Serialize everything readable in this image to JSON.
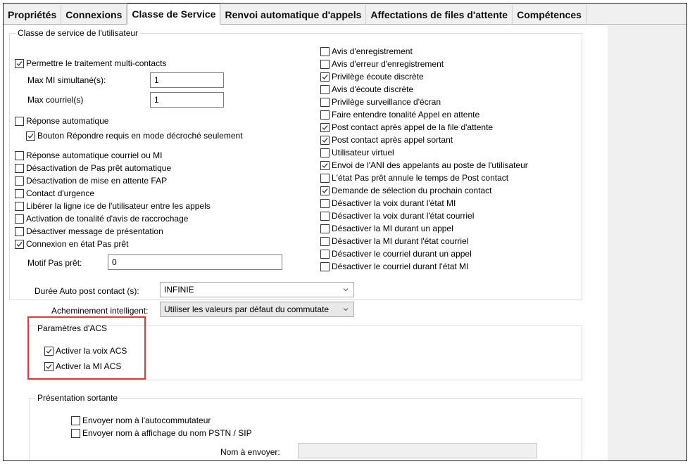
{
  "tabs": [
    {
      "label": "Propriétés",
      "active": false
    },
    {
      "label": "Connexions",
      "active": false
    },
    {
      "label": "Classe de Service",
      "active": true
    },
    {
      "label": "Renvoi automatique d'appels",
      "active": false
    },
    {
      "label": "Affectations de files d'attente",
      "active": false
    },
    {
      "label": "Compétences",
      "active": false
    }
  ],
  "cos_group": {
    "title": "Classe de service de l'utilisateur"
  },
  "multi_contact": {
    "label": "Permettre le traitement multi-contacts",
    "checked": true,
    "max_im_label": "Max MI simultané(s):",
    "max_im_value": "1",
    "max_email_label": "Max courriel(s)",
    "max_email_value": "1"
  },
  "auto_answer": {
    "label": "Réponse automatique",
    "checked": false,
    "sub_label": "Bouton Répondre requis en mode décroché seulement",
    "sub_checked": true
  },
  "left_options": [
    {
      "label": "Réponse automatique courriel ou MI",
      "checked": false
    },
    {
      "label": "Désactivation de Pas prêt automatique",
      "checked": false
    },
    {
      "label": "Désactivation de mise en attente FAP",
      "checked": false
    },
    {
      "label": "Contact d'urgence",
      "checked": false
    },
    {
      "label": "Libérer la ligne ice de l'utilisateur entre les appels",
      "checked": false
    },
    {
      "label": "Activation de tonalité d'avis de raccrochage",
      "checked": false
    },
    {
      "label": "Désactiver message de présentation",
      "checked": false
    },
    {
      "label": "Connexion en état Pas prêt",
      "checked": true
    }
  ],
  "not_ready_reason": {
    "label": "Motif Pas prêt:",
    "value": "0"
  },
  "right_options": [
    {
      "label": "Avis d'enregistrement",
      "checked": false
    },
    {
      "label": "Avis d'erreur d'enregistrement",
      "checked": false
    },
    {
      "label": "Privilège écoute discrète",
      "checked": true
    },
    {
      "label": "Avis d'écoute discrète",
      "checked": false
    },
    {
      "label": "Privilège surveillance d'écran",
      "checked": false
    },
    {
      "label": "Faire entendre tonalité Appel en attente",
      "checked": false
    },
    {
      "label": "Post contact après appel de la file d'attente",
      "checked": true
    },
    {
      "label": "Post contact après appel sortant",
      "checked": true
    },
    {
      "label": "Utilisateur virtuel",
      "checked": false
    },
    {
      "label": "Envoi de l'ANI des appelants au poste de l'utilisateur",
      "checked": true
    },
    {
      "label": "L'état Pas prêt annule le temps de Post contact",
      "checked": false
    },
    {
      "label": "Demande de sélection du prochain contact",
      "checked": true
    },
    {
      "label": "Désactiver la voix durant l'état MI",
      "checked": false
    },
    {
      "label": "Désactiver la voix durant l'état courriel",
      "checked": false
    },
    {
      "label": "Désactiver la MI durant un appel",
      "checked": false
    },
    {
      "label": "Désactiver la MI durant l'état courriel",
      "checked": false
    },
    {
      "label": "Désactiver le courriel durant un appel",
      "checked": false
    },
    {
      "label": "Désactiver le courriel durant l'état MI",
      "checked": false
    }
  ],
  "auto_post_contact": {
    "label": "Durée Auto post contact (s):",
    "value": "INFINIE"
  },
  "smart_routing": {
    "label": "Acheminement intelligent:",
    "value": "Utiliser les valeurs par défaut du commutate"
  },
  "acs_group": {
    "title": "Paramètres d'ACS",
    "options": [
      {
        "label": "Activer la voix ACS",
        "checked": true
      },
      {
        "label": "Activer la MI ACS",
        "checked": true
      }
    ],
    "highlight_color": "#e53935"
  },
  "outgoing_group": {
    "title": "Présentation sortante",
    "options": [
      {
        "label": "Envoyer nom à l'autocommutateur",
        "checked": false
      },
      {
        "label": "Envoyer nom à  affichage du nom PSTN / SIP",
        "checked": false
      }
    ],
    "name_label": "Nom à envoyer:",
    "name_value": ""
  }
}
